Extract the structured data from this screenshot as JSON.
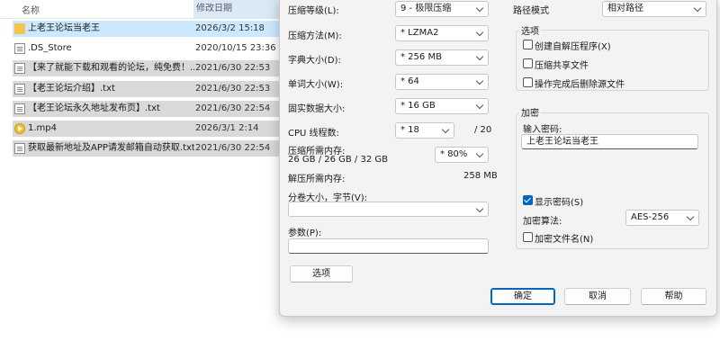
{
  "explorer": {
    "columns": {
      "name": "名称",
      "date": "修改日期"
    },
    "files": [
      {
        "icon": "folder-icon",
        "name": "上老王论坛当老王",
        "date": "2026/3/2 15:18",
        "state": "selected"
      },
      {
        "icon": "document-icon",
        "name": ".DS_Store",
        "date": "2020/10/15 23:36",
        "state": "normal"
      },
      {
        "icon": "document-icon",
        "name": "【来了就能下载和观看的论坛，纯免费！...",
        "date": "2021/6/30 22:53",
        "state": "gray"
      },
      {
        "icon": "document-icon",
        "name": "【老王论坛介绍】.txt",
        "date": "2021/6/30 22:53",
        "state": "gray"
      },
      {
        "icon": "document-icon",
        "name": "【老王论坛永久地址发布页】.txt",
        "date": "2021/6/30 22:54",
        "state": "gray"
      },
      {
        "icon": "media-icon",
        "name": "1.mp4",
        "date": "2026/3/1 2:14",
        "state": "gray"
      },
      {
        "icon": "document-icon",
        "name": "获取最新地址及APP请发邮箱自动获取.txt",
        "date": "2021/6/30 22:54",
        "state": "gray"
      }
    ]
  },
  "dialog": {
    "compression_level": {
      "label": "压缩等级(L):",
      "value": "9 - 极限压缩"
    },
    "compression_method": {
      "label": "压缩方法(M):",
      "value": "* LZMA2"
    },
    "dictionary_size": {
      "label": "字典大小(D):",
      "value": "* 256 MB"
    },
    "word_size": {
      "label": "单词大小(W):",
      "value": "* 64"
    },
    "solid_block": {
      "label": "固实数据大小:",
      "value": "* 16 GB"
    },
    "cpu_threads": {
      "label": "CPU 线程数:",
      "value": "* 18",
      "max": "/ 20"
    },
    "memory_compress": {
      "label": "压缩所需内存:",
      "detail": "26 GB / 26 GB / 32 GB",
      "value": "* 80%"
    },
    "memory_decompress": {
      "label": "解压所需内存:",
      "value": "258 MB"
    },
    "split": {
      "label": "分卷大小，字节(V):",
      "value": ""
    },
    "params": {
      "label": "参数(P):",
      "value": ""
    },
    "options_button": "选项",
    "path_mode": {
      "label": "路径模式",
      "value": "相对路径"
    },
    "options_group": {
      "title": "选项",
      "items": [
        {
          "label": "创建自解压程序(X)",
          "checked": false
        },
        {
          "label": "压缩共享文件",
          "checked": false
        },
        {
          "label": "操作完成后删除源文件",
          "checked": false
        }
      ]
    },
    "encryption": {
      "title": "加密",
      "password_label": "输入密码:",
      "password": "上老王论坛当老王",
      "show_password": {
        "label": "显示密码(S)",
        "checked": true
      },
      "method_label": "加密算法:",
      "method": "AES-256",
      "encrypt_names": {
        "label": "加密文件名(N)",
        "checked": false
      }
    },
    "buttons": {
      "ok": "确定",
      "cancel": "取消",
      "help": "帮助"
    }
  }
}
